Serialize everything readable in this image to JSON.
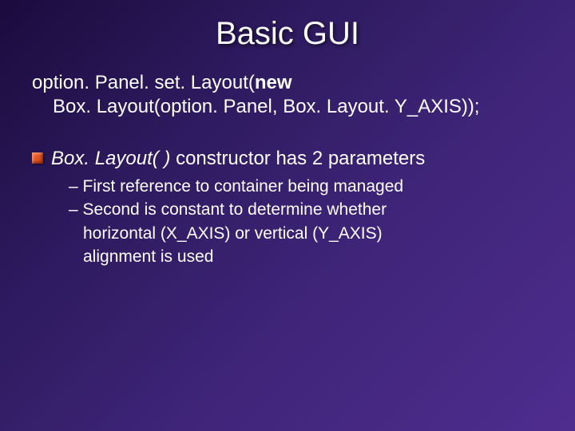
{
  "title": "Basic GUI",
  "code": {
    "line1_pre": "option. Panel. set. Layout(",
    "line1_kw": "new",
    "line2": "Box. Layout(option. Panel, Box. Layout. Y_AXIS));"
  },
  "bullet": {
    "italic_part": "Box. Layout( )",
    "rest": " constructor has 2 parameters"
  },
  "subitems": {
    "s1": "– First reference to container being managed",
    "s2a": "– Second is constant to determine whether",
    "s2b": "horizontal (X_AXIS) or vertical (Y_AXIS)",
    "s2c": "alignment is used"
  }
}
